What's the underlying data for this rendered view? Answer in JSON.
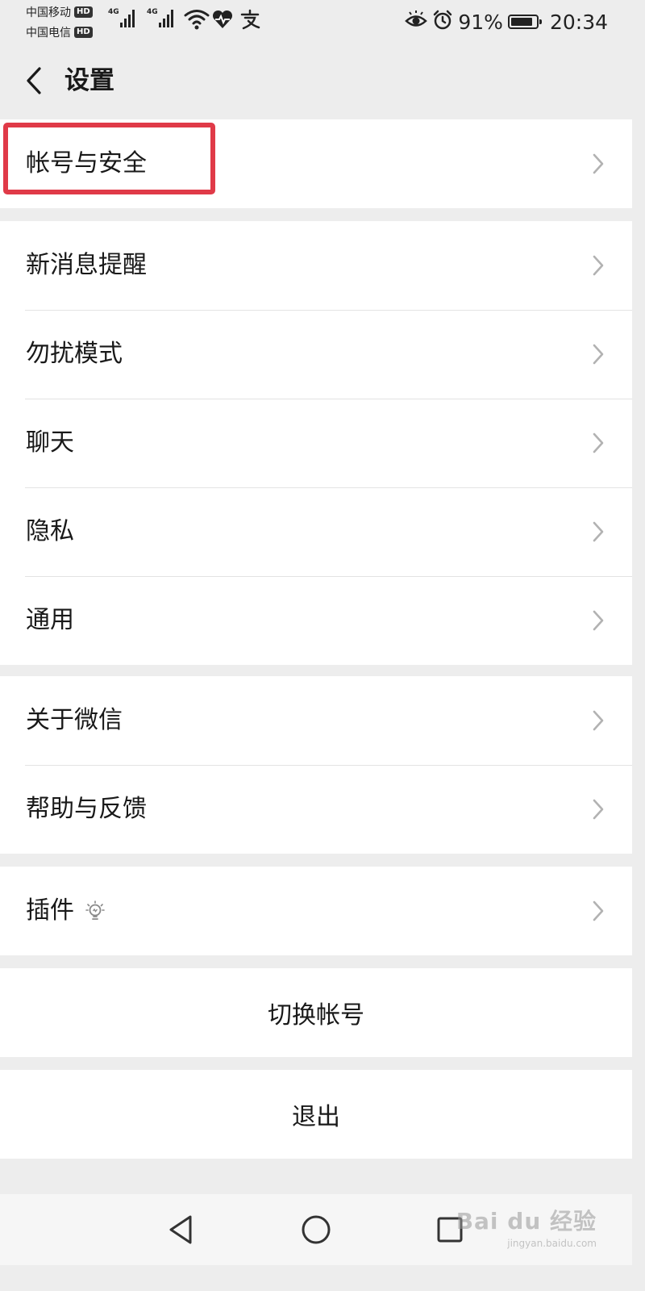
{
  "status_bar": {
    "carrier1": "中国移动",
    "carrier2": "中国电信",
    "hd_badge": "HD",
    "network": "4G",
    "battery_percent": "91%",
    "battery_level": 0.91,
    "time": "20:34",
    "icons": [
      "signal-icon",
      "signal-icon",
      "wifi-icon",
      "health-icon",
      "alipay-icon",
      "eye-icon",
      "alarm-icon",
      "battery-icon"
    ]
  },
  "header": {
    "title": "设置",
    "back_icon": "chevron-left-icon"
  },
  "groups": {
    "account": {
      "items": [
        {
          "label": "帐号与安全"
        }
      ]
    },
    "main": {
      "items": [
        {
          "label": "新消息提醒"
        },
        {
          "label": "勿扰模式"
        },
        {
          "label": "聊天"
        },
        {
          "label": "隐私"
        },
        {
          "label": "通用"
        }
      ]
    },
    "about": {
      "items": [
        {
          "label": "关于微信"
        },
        {
          "label": "帮助与反馈"
        }
      ]
    },
    "plugins": {
      "items": [
        {
          "label": "插件",
          "icon": "lightbulb-icon"
        }
      ]
    }
  },
  "actions": {
    "switch_account": "切换帐号",
    "logout": "退出"
  },
  "highlight_color": "#e03a48",
  "nav_bar": {
    "icons": [
      "back-triangle-icon",
      "home-circle-icon",
      "recents-square-icon"
    ]
  },
  "watermark": {
    "logo": "Bai du 经验",
    "url": "jingyan.baidu.com"
  }
}
